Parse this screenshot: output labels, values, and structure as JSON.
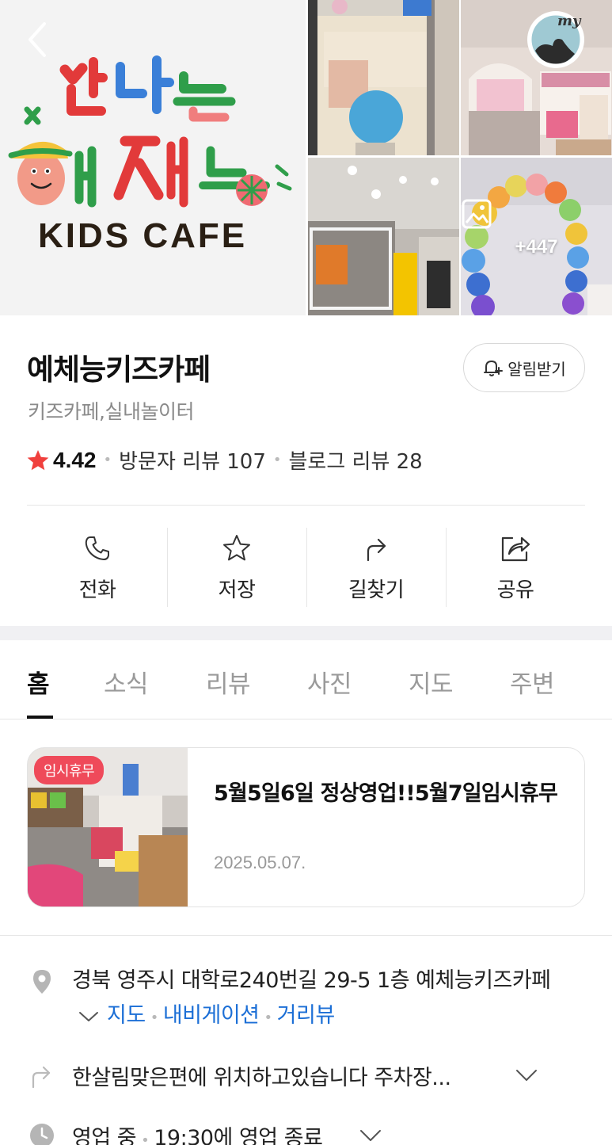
{
  "hero": {
    "logo": {
      "line1": "신나는",
      "line2": "예체능",
      "line3": "KIDS CAFE"
    },
    "my_label": "my",
    "more_photos_count": "+447"
  },
  "place": {
    "name": "예체능키즈카페",
    "category": "키즈카페,실내놀이터",
    "alarm_label": "알림받기",
    "rating": "4.42",
    "visitor_reviews": "방문자 리뷰 107",
    "blog_reviews": "블로그 리뷰 28"
  },
  "actions": [
    {
      "label": "전화",
      "icon": "phone-icon"
    },
    {
      "label": "저장",
      "icon": "star-icon"
    },
    {
      "label": "길찾기",
      "icon": "directions-icon"
    },
    {
      "label": "공유",
      "icon": "share-icon"
    }
  ],
  "tabs": [
    "홈",
    "소식",
    "리뷰",
    "사진",
    "지도",
    "주변"
  ],
  "news": {
    "badge": "임시휴무",
    "title": "5월5일6일 정상영업!!5월7일임시휴무",
    "date": "2025.05.07."
  },
  "info": {
    "address": "경북 영주시 대학로240번길 29-5 1층 예체능키즈카페",
    "map_link": "지도",
    "navigation_link": "내비게이션",
    "streetview_link": "거리뷰",
    "directions": "한살림맞은편에 위치하고있습니다 주차장...",
    "status": "영업 중",
    "hours": "19:30에 영업 종료"
  },
  "colors": {
    "accent_blue": "#1c6fd6",
    "badge_red": "#ef4a5a",
    "star_red": "#f0403d"
  }
}
